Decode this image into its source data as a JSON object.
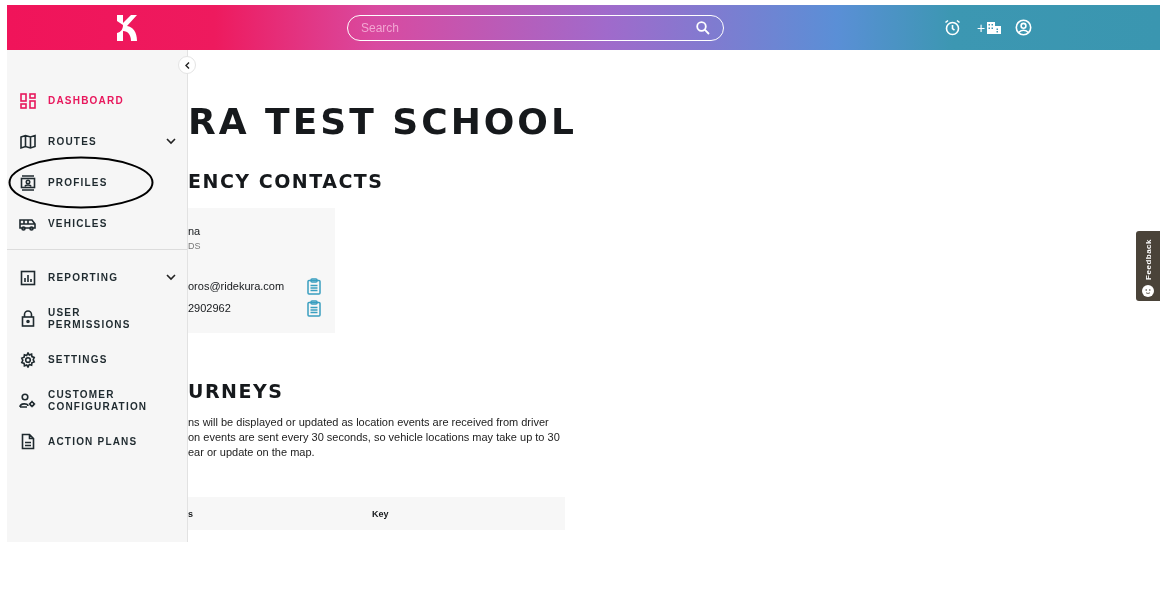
{
  "header": {
    "search": {
      "placeholder": "Search"
    },
    "add_label": "+"
  },
  "sidebar": {
    "sections": [
      {
        "items": [
          {
            "label": "DASHBOARD",
            "selected": true,
            "expandable": false,
            "circled": false
          },
          {
            "label": "ROUTES",
            "selected": false,
            "expandable": true,
            "circled": false
          },
          {
            "label": "PROFILES",
            "selected": false,
            "expandable": false,
            "circled": true
          },
          {
            "label": "VEHICLES",
            "selected": false,
            "expandable": false,
            "circled": false
          }
        ]
      },
      {
        "items": [
          {
            "label": "REPORTING",
            "selected": false,
            "expandable": true,
            "circled": false
          },
          {
            "label": "USER PERMISSIONS",
            "selected": false,
            "expandable": false,
            "circled": false
          },
          {
            "label": "SETTINGS",
            "selected": false,
            "expandable": false,
            "circled": false
          },
          {
            "label": "CUSTOMER CONFIGURATION",
            "selected": false,
            "expandable": false,
            "circled": false
          },
          {
            "label": "ACTION PLANS",
            "selected": false,
            "expandable": false,
            "circled": false
          }
        ]
      }
    ]
  },
  "main": {
    "title": "RA TEST SCHOOL",
    "contacts": {
      "heading": "ENCY CONTACTS",
      "card": {
        "name": "na",
        "role": "DS",
        "email": "oros@ridekura.com",
        "phone": "2902962"
      }
    },
    "journeys": {
      "heading": "URNEYS",
      "lines": [
        "ns will be displayed or updated as location events are received from driver",
        "on events are sent every 30 seconds, so vehicle locations may take up to 30",
        "ear or update on the map."
      ],
      "table": {
        "columns": [
          "s",
          "Key"
        ]
      }
    }
  },
  "feedback": {
    "label": "Feedback"
  }
}
